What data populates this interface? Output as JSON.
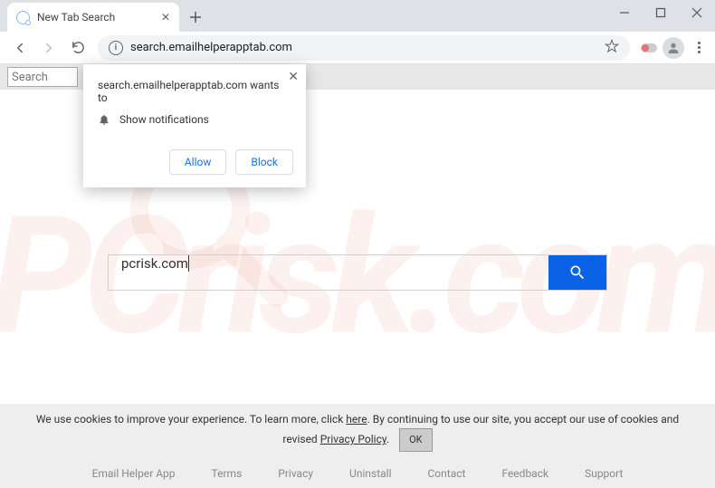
{
  "window": {
    "title": "New Tab Search"
  },
  "addressBar": {
    "url": "search.emailhelperapptab.com"
  },
  "topSearch": {
    "placeholder": "Search"
  },
  "notification": {
    "title_prefix": "search.emailhelperapptab.com wants to",
    "permission": "Show notifications",
    "allow": "Allow",
    "block": "Block"
  },
  "centerSearch": {
    "value": "pcrisk.com"
  },
  "cookies": {
    "text1": "We use cookies to improve your experience. To learn more, click ",
    "here": "here",
    "text2": ". By continuing to use our site, you accept our use of cookies and revised ",
    "policy": "Privacy Policy",
    "text3": ".",
    "ok": "OK"
  },
  "footer": {
    "items": [
      "Email Helper App",
      "Terms",
      "Privacy",
      "Uninstall",
      "Contact",
      "Feedback",
      "Support"
    ]
  },
  "watermark": {
    "text": "PCrisk.com"
  }
}
